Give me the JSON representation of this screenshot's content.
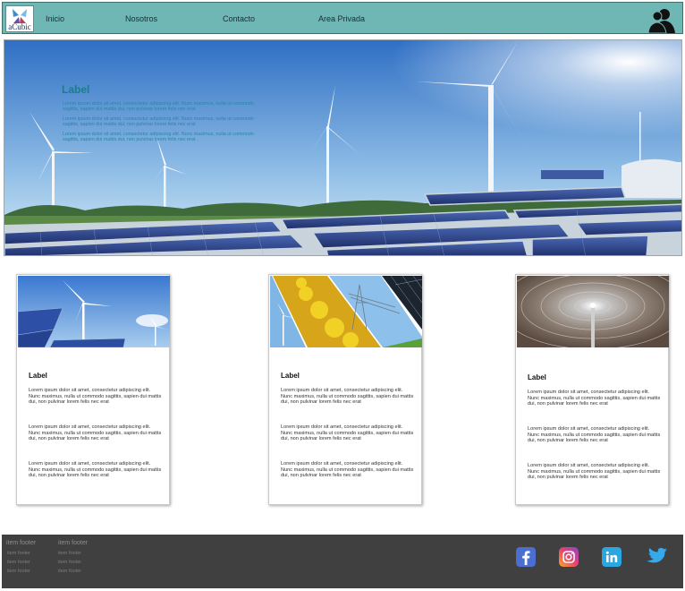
{
  "header": {
    "logo_text": "aCubic",
    "nav": [
      "Inicio",
      "Nosotros",
      "Contacto",
      "Area Privada"
    ]
  },
  "hero": {
    "title": "Label",
    "paragraphs": [
      "Lorem ipsum dolor sit amet, consectetur adipiscing elit. Nunc maximus, nulla ut commodo sagittis, sapien dui mattis dui, non pulvinar lorem felis nec erat",
      "Lorem ipsum dolor sit amet, consectetur adipiscing elit. Nunc maximus, nulla ut commodo sagittis, sapien dui mattis dui, non pulvinar lorem felis nec erat",
      "Lorem ipsum dolor sit amet, consectetur adipiscing elit. Nunc maximus, nulla ut commodo sagittis, sapien dui mattis dui, non pulvinar lorem felis nec erat"
    ]
  },
  "cards": [
    {
      "title": "Label",
      "image": "wind-turbines-solar-panels",
      "paragraphs": [
        "Lorem ipsum dolor sit amet, consectetur adipiscing elit. Nunc maximus, nulla ut commodo sagittis, sapien dui mattis dui, non pulvinar lorem felis nec erat",
        "Lorem ipsum dolor sit amet, consectetur adipiscing elit. Nunc maximus, nulla ut commodo sagittis, sapien dui mattis dui, non pulvinar lorem felis nec erat",
        "Lorem ipsum dolor sit amet, consectetur adipiscing elit. Nunc maximus, nulla ut commodo sagittis, sapien dui mattis dui, non pulvinar lorem felis nec erat"
      ]
    },
    {
      "title": "Label",
      "image": "energy-collage",
      "paragraphs": [
        "Lorem ipsum dolor sit amet, consectetur adipiscing elit. Nunc maximus, nulla ut commodo sagittis, sapien dui mattis dui, non pulvinar lorem felis nec erat",
        "Lorem ipsum dolor sit amet, consectetur adipiscing elit. Nunc maximus, nulla ut commodo sagittis, sapien dui mattis dui, non pulvinar lorem felis nec erat",
        "Lorem ipsum dolor sit amet, consectetur adipiscing elit. Nunc maximus, nulla ut commodo sagittis, sapien dui mattis dui, non pulvinar lorem felis nec erat"
      ]
    },
    {
      "title": "Label",
      "image": "solar-thermal-mirror-field",
      "paragraphs": [
        "Lorem ipsum dolor sit amet, consectetur adipiscing elit. Nunc maximus, nulla ut commodo sagittis, sapien dui mattis dui, non pulvinar lorem felis nec erat",
        "Lorem ipsum dolor sit amet, consectetur adipiscing elit. Nunc maximus, nulla ut commodo sagittis, sapien dui mattis dui, non pulvinar lorem felis nec erat",
        "Lorem ipsum dolor sit amet, consectetur adipiscing elit. Nunc maximus, nulla ut commodo sagittis, sapien dui mattis dui, non pulvinar lorem felis nec erat"
      ]
    }
  ],
  "footer": {
    "columns": [
      {
        "heading": "item footer",
        "items": [
          "item footer",
          "item footer",
          "item footer"
        ]
      },
      {
        "heading": "item footer",
        "items": [
          "item footer",
          "item footer",
          "item footer"
        ]
      }
    ],
    "social": [
      {
        "icon": "facebook-icon",
        "color": "#4a6fd1"
      },
      {
        "icon": "instagram-icon",
        "color": "#e8436f"
      },
      {
        "icon": "linkedin-icon",
        "color": "#2aa7e0"
      },
      {
        "icon": "twitter-icon",
        "color": "#35a9ea"
      }
    ]
  },
  "colors": {
    "nav_bg": "#6fb7b5",
    "footer_bg": "#404040",
    "hero_title": "#1d7c8c"
  }
}
